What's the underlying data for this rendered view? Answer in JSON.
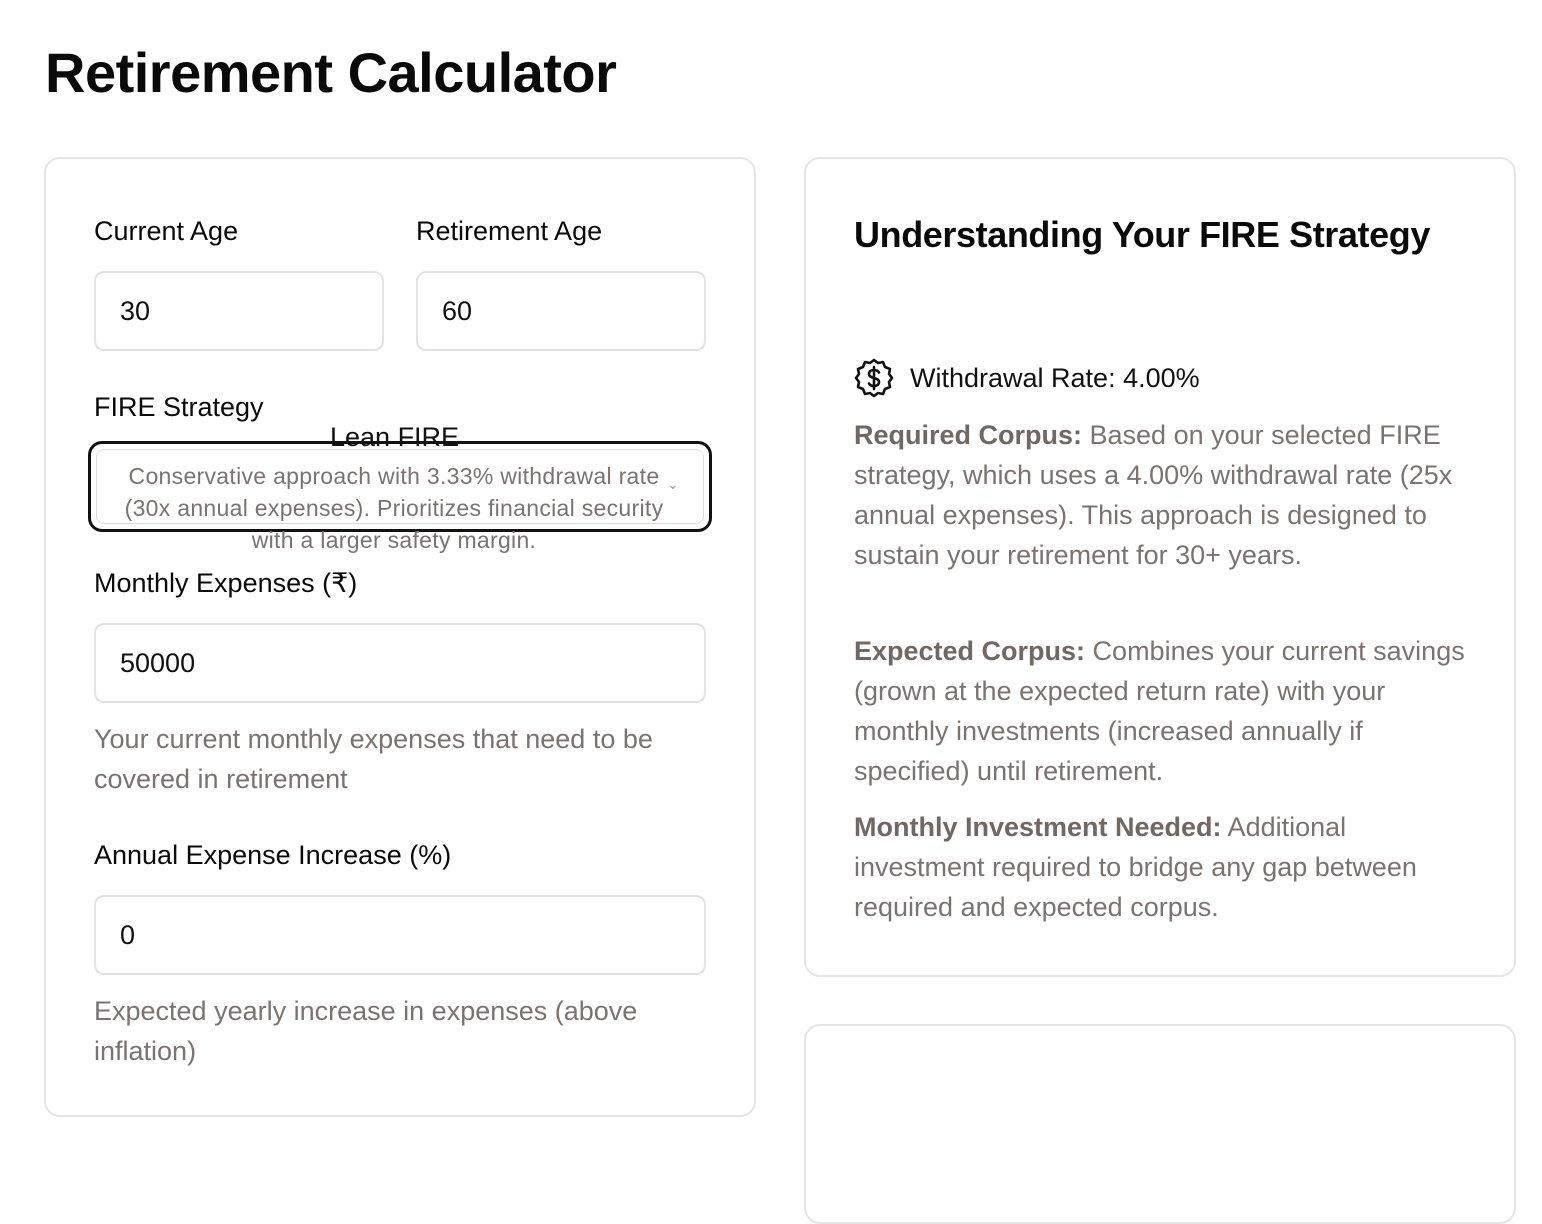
{
  "page": {
    "title": "Retirement Calculator"
  },
  "form": {
    "current_age": {
      "label": "Current Age",
      "value": "30"
    },
    "retirement_age": {
      "label": "Retirement Age",
      "value": "60"
    },
    "fire_strategy": {
      "label": "FIRE Strategy",
      "selected_name": "Lean FIRE",
      "selected_description": "Conservative approach with 3.33% withdrawal rate (30x annual expenses). Prioritizes financial security with a larger safety margin."
    },
    "monthly_expenses": {
      "label": "Monthly Expenses (₹)",
      "value": "50000",
      "helper": "Your current monthly expenses that need to be covered in retirement"
    },
    "annual_expense_increase": {
      "label": "Annual Expense Increase (%)",
      "value": "0",
      "helper": "Expected yearly increase in expenses (above inflation)"
    }
  },
  "info": {
    "title": "Understanding Your FIRE Strategy",
    "withdrawal_rate": "Withdrawal Rate: 4.00%",
    "withdrawal_icon": "dollar-badge-icon",
    "required_corpus": {
      "heading": "Required Corpus:",
      "text": " Based on your selected FIRE strategy, which uses a 4.00% withdrawal rate (25x annual expenses). This approach is designed to sustain your retirement for 30+ years."
    },
    "expected_corpus": {
      "heading": "Expected Corpus:",
      "text": " Combines your current savings (grown at the expected return rate) with your monthly investments (increased annually if specified) until retirement."
    },
    "monthly_investment": {
      "heading": "Monthly Investment Needed:",
      "text": " Additional investment required to bridge any gap between required and expected corpus."
    }
  }
}
